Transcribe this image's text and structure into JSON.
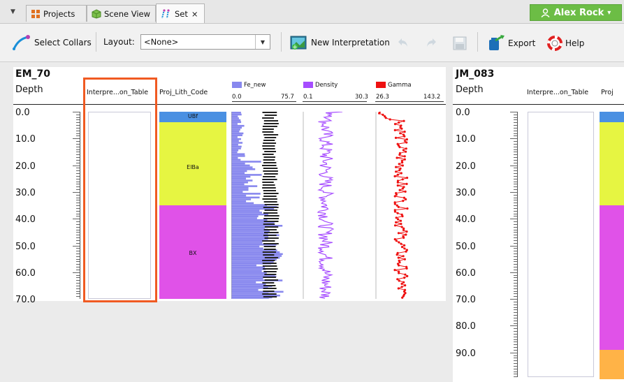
{
  "tabs": [
    {
      "label": "Projects",
      "icon": "projects-grid-icon"
    },
    {
      "label": "Scene View",
      "icon": "cube-icon"
    },
    {
      "label": "Set",
      "icon": "drillhole-set-icon",
      "close": "×"
    }
  ],
  "user": {
    "name": "Alex Rock",
    "icon": "user-icon",
    "caret": "▾"
  },
  "toolbar": {
    "select_collars": "Select Collars",
    "layout_label": "Layout:",
    "layout_value": "<None>",
    "new_interpretation": "New Interpretation",
    "export": "Export",
    "help": "Help"
  },
  "logs": [
    {
      "hole": "EM_70",
      "depth_header": "Depth",
      "depth_ticks": [
        "0.0",
        "10.0",
        "20.0",
        "30.0",
        "40.0",
        "50.0",
        "60.0",
        "70.0"
      ],
      "columns": {
        "interpretation": "Interpre...on_Table",
        "lith": "Proj_Lith_Code",
        "fe": {
          "name": "Fe_new",
          "min": "0.0",
          "max": "75.7",
          "color": "#8888ee"
        },
        "density": {
          "name": "Density",
          "min": "0.1",
          "max": "30.3",
          "color": "#a64dff"
        },
        "gamma": {
          "name": "Gamma",
          "min": "26.3",
          "max": "143.2",
          "color": "#ee1111"
        }
      },
      "lith_units": [
        {
          "code": "UBf",
          "from": 0,
          "to": 4,
          "color": "#4a90e2"
        },
        {
          "code": "ElBa",
          "from": 4,
          "to": 35,
          "color": "#e6f542"
        },
        {
          "code": "BX",
          "from": 35,
          "to": 70,
          "color": "#e052e8"
        }
      ]
    },
    {
      "hole": "JM_083",
      "depth_header": "Depth",
      "depth_ticks": [
        "0.0",
        "10.0",
        "20.0",
        "30.0",
        "40.0",
        "50.0",
        "60.0",
        "70.0",
        "80.0",
        "90.0"
      ],
      "columns": {
        "interpretation": "Interpre...on_Table",
        "lith": "Proj"
      },
      "lith_units": [
        {
          "from": 0,
          "to": 4,
          "color": "#4a90e2"
        },
        {
          "from": 4,
          "to": 35,
          "color": "#e6f542"
        },
        {
          "from": 35,
          "to": 89,
          "color": "#e052e8"
        },
        {
          "from": 89,
          "to": 100,
          "color": "#ffb347"
        }
      ]
    }
  ]
}
